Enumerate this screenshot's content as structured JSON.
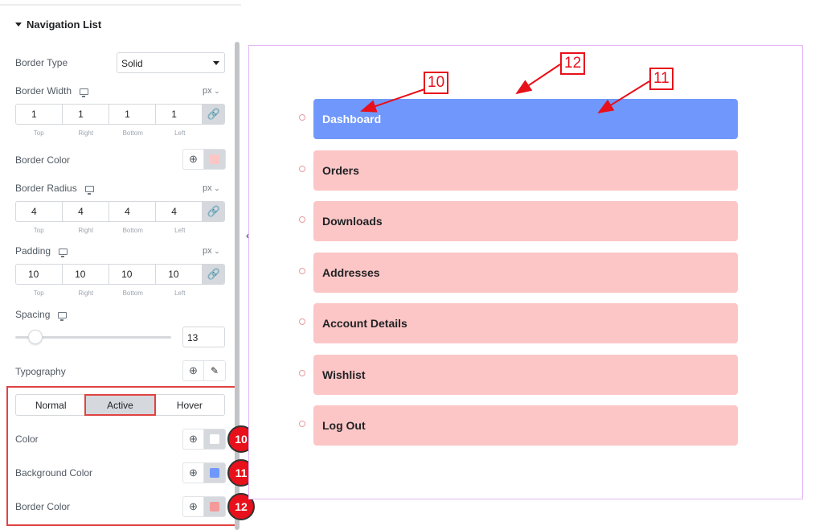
{
  "panel": {
    "section_title": "Navigation List",
    "border_type": {
      "label": "Border Type",
      "value": "Solid"
    },
    "border_width": {
      "label": "Border Width",
      "unit": "px",
      "values": [
        "1",
        "1",
        "1",
        "1"
      ]
    },
    "dim_labels": [
      "Top",
      "Right",
      "Bottom",
      "Left"
    ],
    "border_color": {
      "label": "Border Color",
      "swatch": "#fcc6c6"
    },
    "border_radius": {
      "label": "Border Radius",
      "unit": "px",
      "values": [
        "4",
        "4",
        "4",
        "4"
      ]
    },
    "padding": {
      "label": "Padding",
      "unit": "px",
      "values": [
        "10",
        "10",
        "10",
        "10"
      ]
    },
    "spacing": {
      "label": "Spacing",
      "value": "13"
    },
    "typography": {
      "label": "Typography"
    },
    "tabs": [
      "Normal",
      "Active",
      "Hover"
    ],
    "active_tab": "Active",
    "active_color": {
      "label": "Color",
      "swatch": "#ffffff"
    },
    "active_bg_color": {
      "label": "Background Color",
      "swatch": "#7098fc"
    },
    "active_border_color": {
      "label": "Border Color",
      "swatch": "#f49a9a"
    },
    "badges": [
      "10",
      "11",
      "12"
    ]
  },
  "preview": {
    "items": [
      "Dashboard",
      "Orders",
      "Downloads",
      "Addresses",
      "Account Details",
      "Wishlist",
      "Log Out"
    ],
    "active_index": 0,
    "colors": {
      "active_bg": "#7098fc",
      "active_text": "#ffffff",
      "item_bg": "#fcc6c6"
    }
  },
  "annotations": [
    "10",
    "12",
    "11"
  ]
}
